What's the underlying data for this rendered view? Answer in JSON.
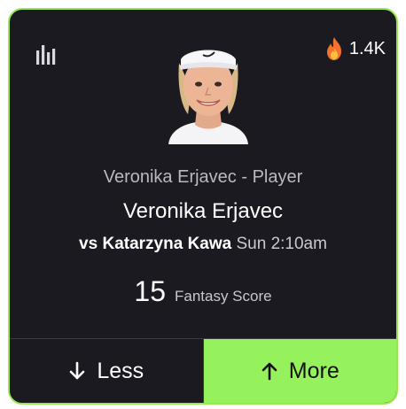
{
  "card": {
    "stats_icon": "bar-chart-icon",
    "popularity_icon": "fire-icon",
    "popularity_count": "1.4K",
    "avatar_icon": "player-headshot"
  },
  "player": {
    "subtitle": "Veronika Erjavec - Player",
    "name": "Veronika Erjavec"
  },
  "matchup": {
    "vs_label": "vs",
    "opponent": "Katarzyna Kawa",
    "time": "Sun 2:10am"
  },
  "projection": {
    "value": "15",
    "stat": "Fantasy Score"
  },
  "actions": {
    "less_label": "Less",
    "less_icon": "arrow-down-icon",
    "more_label": "More",
    "more_icon": "arrow-up-icon"
  },
  "colors": {
    "accent": "#96f25c",
    "card_bg": "#1a1a20",
    "border": "#9be650"
  }
}
